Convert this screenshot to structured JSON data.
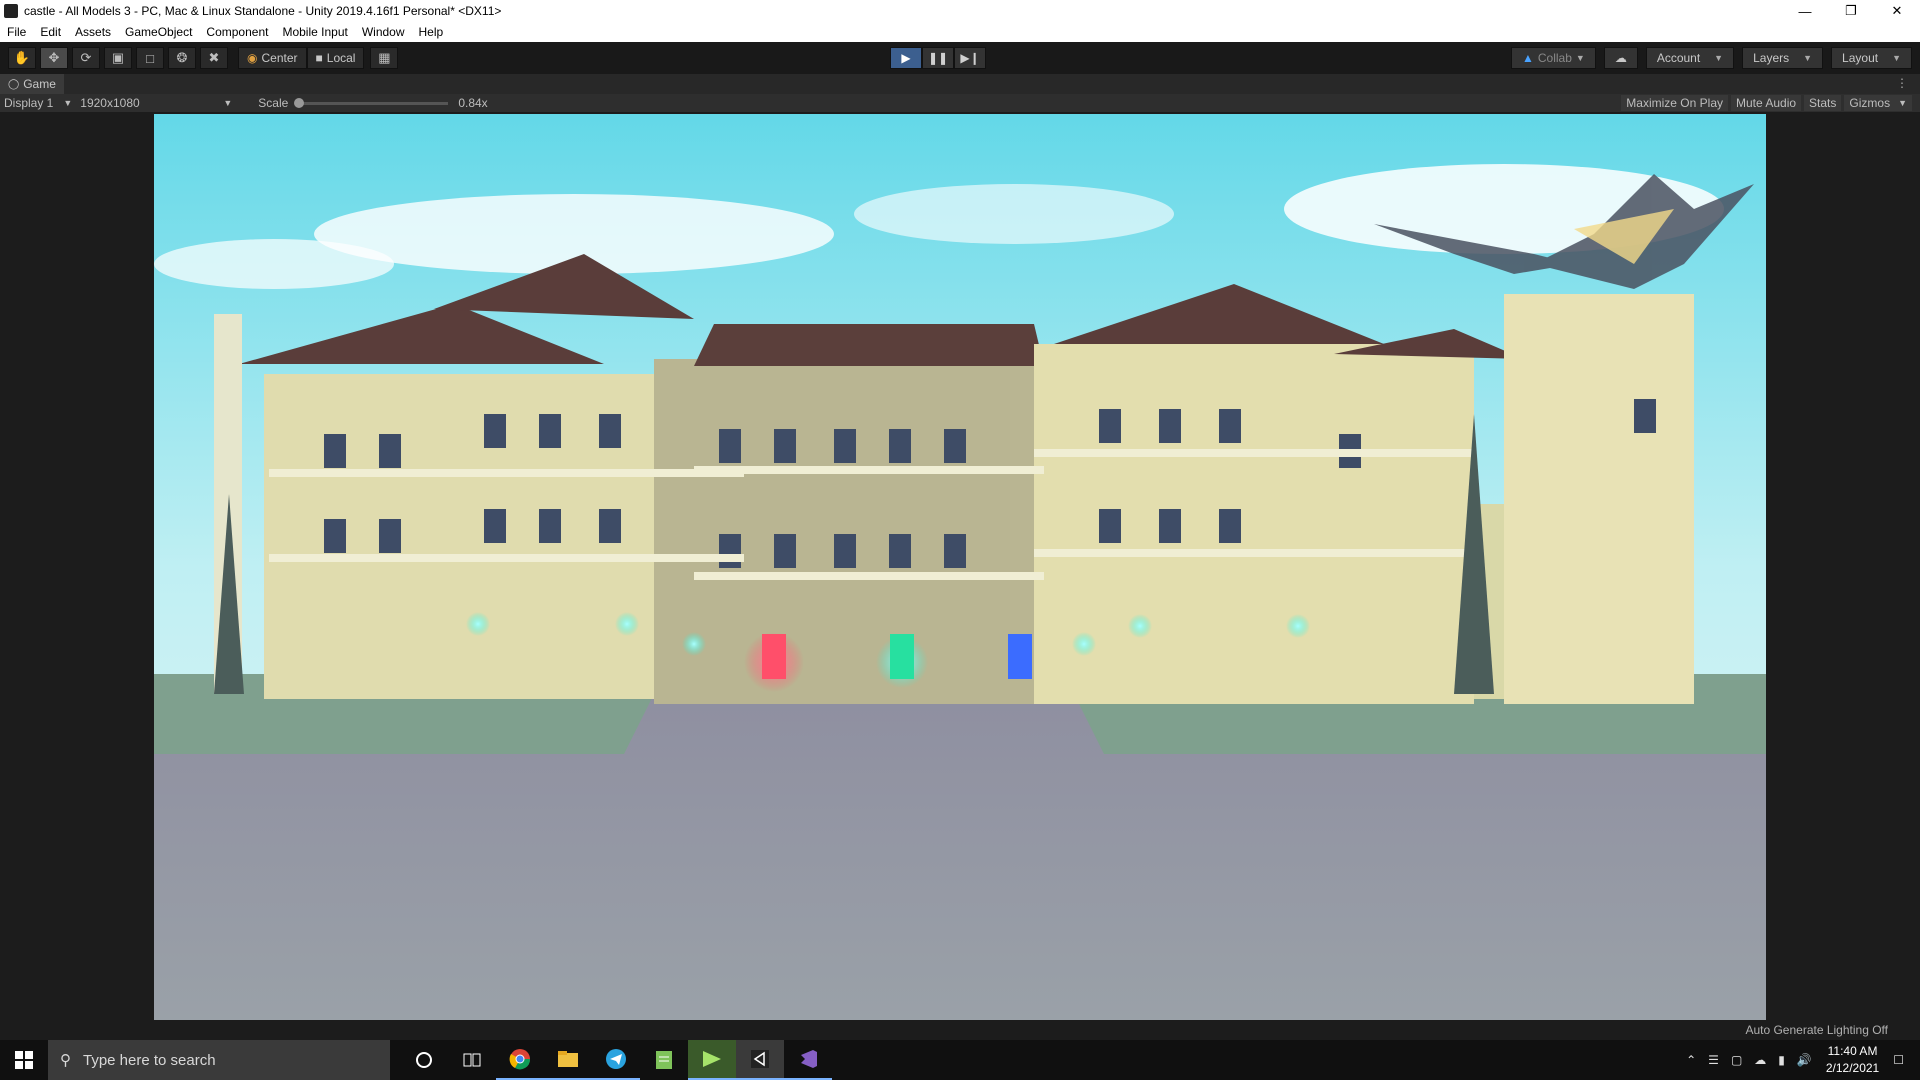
{
  "window": {
    "title": "castle - All Models 3 - PC, Mac & Linux Standalone - Unity 2019.4.16f1 Personal* <DX11>"
  },
  "menu": {
    "items": [
      "File",
      "Edit",
      "Assets",
      "GameObject",
      "Component",
      "Mobile Input",
      "Window",
      "Help"
    ]
  },
  "toolbar": {
    "pivot_label": "Center",
    "space_label": "Local",
    "collab_label": "Collab",
    "account_label": "Account",
    "layers_label": "Layers",
    "layout_label": "Layout"
  },
  "game_tab": {
    "label": "Game"
  },
  "game_bar": {
    "display_label": "Display 1",
    "resolution_label": "1920x1080",
    "scale_label": "Scale",
    "scale_value": "0.84x",
    "maximize_label": "Maximize On Play",
    "mute_label": "Mute Audio",
    "stats_label": "Stats",
    "gizmos_label": "Gizmos"
  },
  "status_bar": {
    "text": "Auto Generate Lighting Off"
  },
  "taskbar": {
    "search_placeholder": "Type here to search",
    "time": "11:40 AM",
    "date": "2/12/2021"
  },
  "colors": {
    "play_active": "#3c5f8f",
    "door_red": "#ff4f6a",
    "door_green": "#27e0a0",
    "door_blue": "#3b6cff",
    "lamp": "#2ff2d8"
  }
}
